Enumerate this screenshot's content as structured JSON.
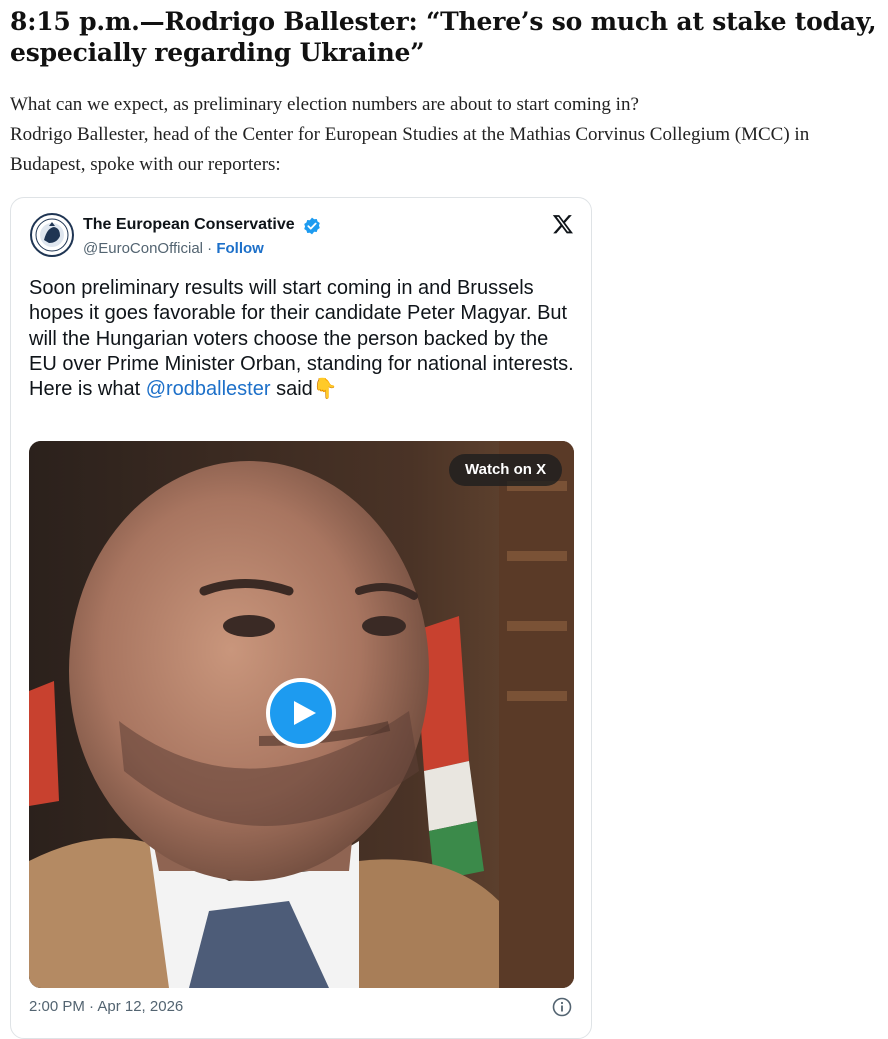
{
  "article": {
    "headline": "8:15 p.m.—Rodrigo Ballester: “There’s so much at stake today, especially regarding Ukraine”",
    "paragraph_1": "What can we expect, as preliminary election numbers are about to start coming in?",
    "paragraph_2": "Rodrigo Ballester, head of the Center for European Studies at the Mathias Corvinus Collegium (MCC) in Budapest, spoke with our reporters:"
  },
  "tweet": {
    "account_name": "The European Conservative",
    "handle": "@EuroConOfficial",
    "separator": " · ",
    "follow_label": "Follow",
    "text_lines": [
      "Soon preliminary results will start coming in and Brussels hopes it goes favorable for their candidate Peter Magyar. But will the Hungarian voters choose the person backed by the EU over Prime Minister Orban, standing for national interests."
    ],
    "closing_prefix": "Here is what ",
    "mention": "@rodballester",
    "closing_suffix": " said",
    "closing_emoji": "👇",
    "watch_label": "Watch on X",
    "timestamp": "2:00 PM · Apr 12, 2026",
    "accent_color": "#1d9bf0",
    "icons": [
      "verified-badge-icon",
      "x-logo-icon",
      "play-icon",
      "info-icon"
    ]
  }
}
